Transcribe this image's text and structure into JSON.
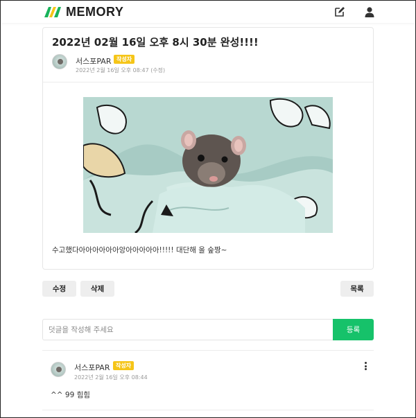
{
  "header": {
    "logo_text": "MEMORY",
    "icons": {
      "edit": "edit-icon",
      "user": "user-icon"
    },
    "colors": {
      "logo_green": "#19b35a",
      "logo_yellow": "#f5c518"
    }
  },
  "post": {
    "title": "2022년 02월 16일 오후 8시 30분 완성!!!!",
    "author": "서스포PAR",
    "author_badge": "작성자",
    "meta": "2022년 2월 16일 오후 08:47 (수정)",
    "body": "수고했다아아아아아아앙아아아아아!!!!! 대단해 올 숲짱~"
  },
  "actions": {
    "edit_label": "수정",
    "delete_label": "삭제",
    "list_label": "목록"
  },
  "comment_form": {
    "placeholder": "덧글을 작성해 주세요",
    "value": "",
    "submit_label": "등록"
  },
  "comments": [
    {
      "author": "서스포PAR",
      "badge": "작성자",
      "time": "2022년 2월 16일 오후 08:44",
      "text": "^^ 99 힘힘"
    }
  ],
  "colors": {
    "accent": "#16c26a",
    "badge": "#f5c518",
    "button_bg": "#eeeeee"
  }
}
